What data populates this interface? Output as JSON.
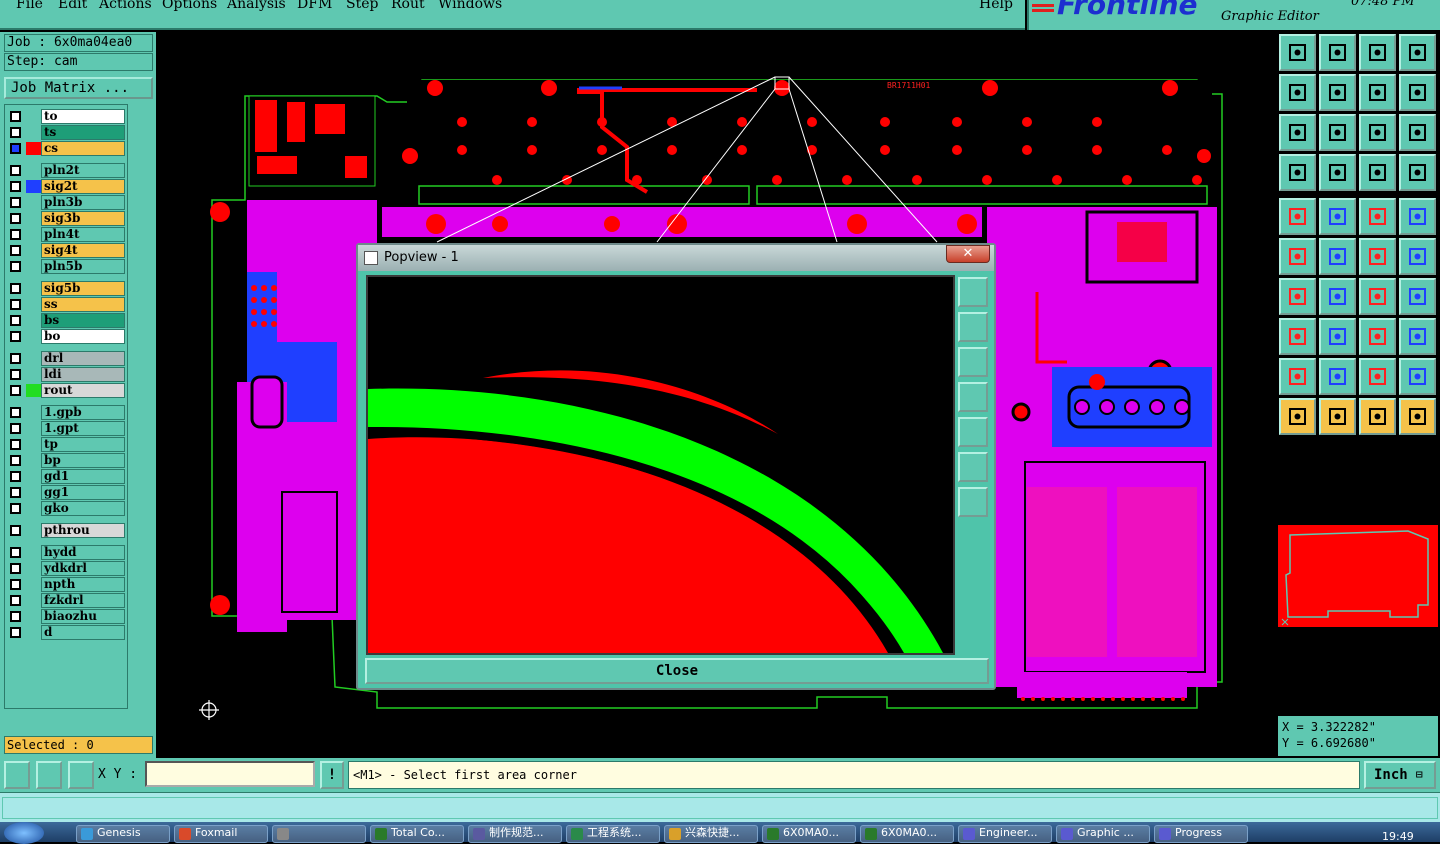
{
  "menu": {
    "items": [
      "File",
      "Edit",
      "Actions",
      "Options",
      "Analysis",
      "DFM",
      "Step",
      "Rout",
      "Windows"
    ],
    "help": "Help"
  },
  "brand": {
    "logo": "Frontline",
    "subtitle": "Graphic Editor",
    "clock": "07:48 PM"
  },
  "left_panel": {
    "job": "Job : 6x0ma04ea0",
    "step": "Step: cam",
    "job_matrix": "Job Matrix ...",
    "selected": "Selected : 0"
  },
  "layers": [
    {
      "name": "to",
      "color": "#ffffff",
      "swatch": ""
    },
    {
      "name": "ts",
      "color": "#1e9e78",
      "swatch": ""
    },
    {
      "name": "cs",
      "color": "#f5c24a",
      "swatch": "#ff0000",
      "active": true
    },
    {
      "name": "pln2t",
      "color": "#5fc8b1",
      "swatch": ""
    },
    {
      "name": "sig2t",
      "color": "#f5c24a",
      "swatch": "#1f3fff"
    },
    {
      "name": "pln3b",
      "color": "#5fc8b1",
      "swatch": ""
    },
    {
      "name": "sig3b",
      "color": "#f5c24a",
      "swatch": ""
    },
    {
      "name": "pln4t",
      "color": "#5fc8b1",
      "swatch": ""
    },
    {
      "name": "sig4t",
      "color": "#f5c24a",
      "swatch": ""
    },
    {
      "name": "pln5b",
      "color": "#5fc8b1",
      "swatch": ""
    },
    {
      "name": "sig5b",
      "color": "#f5c24a",
      "swatch": ""
    },
    {
      "name": "ss",
      "color": "#f5c24a",
      "swatch": ""
    },
    {
      "name": "bs",
      "color": "#1e9e78",
      "swatch": ""
    },
    {
      "name": "bo",
      "color": "#ffffff",
      "swatch": ""
    },
    {
      "name": "drl",
      "color": "#a8b8b8",
      "swatch": ""
    },
    {
      "name": "ldi",
      "color": "#a8b8b8",
      "swatch": ""
    },
    {
      "name": "rout",
      "color": "#d8d8d8",
      "swatch": "#22dd22"
    },
    {
      "name": "1.gpb",
      "color": "#5fc8b1",
      "swatch": ""
    },
    {
      "name": "1.gpt",
      "color": "#5fc8b1",
      "swatch": ""
    },
    {
      "name": "tp",
      "color": "#5fc8b1",
      "swatch": ""
    },
    {
      "name": "bp",
      "color": "#5fc8b1",
      "swatch": ""
    },
    {
      "name": "gd1",
      "color": "#5fc8b1",
      "swatch": ""
    },
    {
      "name": "gg1",
      "color": "#5fc8b1",
      "swatch": ""
    },
    {
      "name": "gko",
      "color": "#5fc8b1",
      "swatch": ""
    },
    {
      "name": "pthrou",
      "color": "#d8d8d8",
      "swatch": ""
    },
    {
      "name": "hydd",
      "color": "#5fc8b1",
      "swatch": ""
    },
    {
      "name": "ydkdrl",
      "color": "#5fc8b1",
      "swatch": ""
    },
    {
      "name": "npth",
      "color": "#5fc8b1",
      "swatch": ""
    },
    {
      "name": "fzkdrl",
      "color": "#5fc8b1",
      "swatch": ""
    },
    {
      "name": "biaozhu",
      "color": "#5fc8b1",
      "swatch": ""
    },
    {
      "name": "d",
      "color": "#5fc8b1",
      "swatch": ""
    }
  ],
  "canvas": {
    "board_label": "BR1711H01"
  },
  "popup": {
    "title": "Popview - 1",
    "close_x": "✕",
    "close_button": "Close"
  },
  "right_panel": {
    "x_readout": "X = 3.322282\"",
    "y_readout": "Y = 6.692680\""
  },
  "bottom": {
    "xy_label": "X Y :",
    "xy_value": "",
    "warn": "!",
    "prompt": "<M1> - Select first area corner",
    "units": "Inch"
  },
  "taskbar": {
    "tasks": [
      "Genesis",
      "Foxmail",
      "",
      "Total Co...",
      "制作规范...",
      "工程系统...",
      "兴森快捷...",
      "6X0MA0...",
      "6X0MA0...",
      "Engineer...",
      "Graphic ...",
      "Progress"
    ],
    "clock": "19:49"
  }
}
